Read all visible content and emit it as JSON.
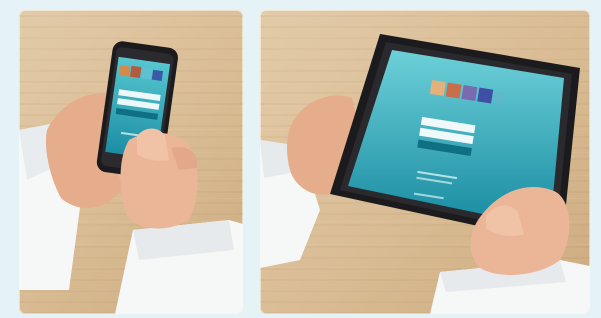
{
  "photos": [
    {
      "device": "smartphone",
      "screen": {
        "tile_colors": [
          "#d58a4a",
          "#b55a3c",
          "#5ec1d1",
          "#3a5aa6"
        ],
        "screen_gradient": [
          "#57c6d0",
          "#1c8ea4"
        ]
      }
    },
    {
      "device": "tablet",
      "screen": {
        "tile_colors": [
          "#e3b27c",
          "#c96e4b",
          "#7a6bb0",
          "#3f4fa6",
          "#5fb7c7"
        ],
        "screen_gradient": [
          "#6dd0d8",
          "#178aa0"
        ]
      }
    }
  ],
  "colors": {
    "background": "#e6f3f6",
    "wood": "#d9bc94",
    "sleeve": "#f7f8f8",
    "skin": "#e9b597",
    "device_frame": "#1b1b1e"
  }
}
